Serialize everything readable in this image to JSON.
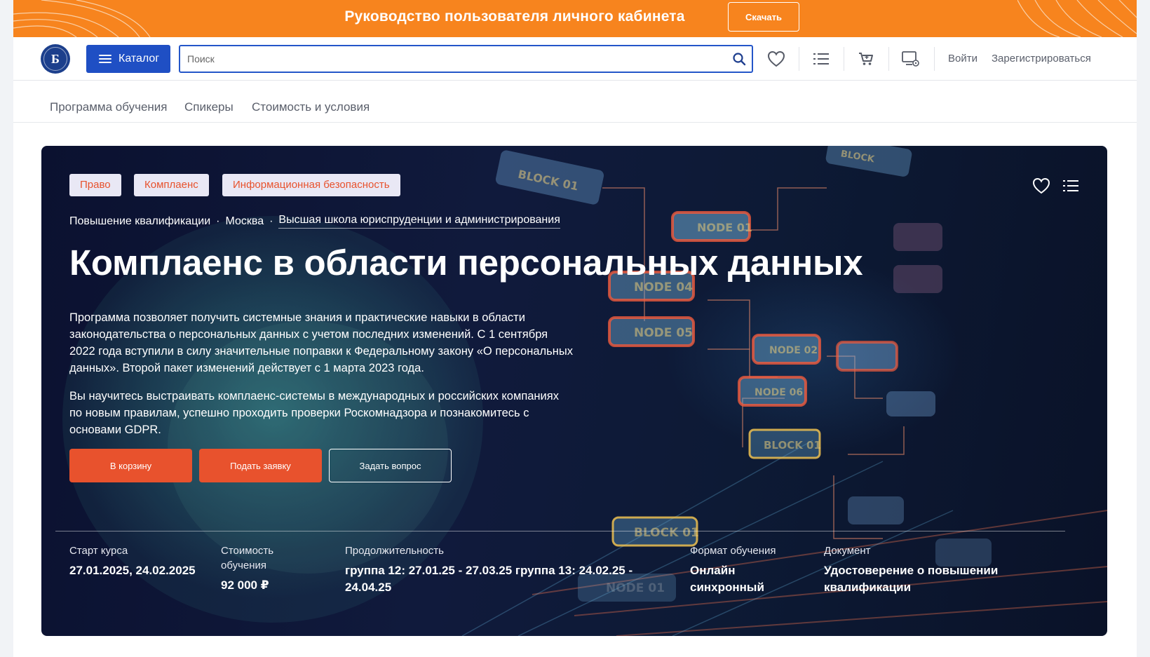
{
  "banner": {
    "title": "Руководство пользователя личного кабинета",
    "download_label": "Скачать",
    "color": "#f7841e"
  },
  "header": {
    "logo_letter": "Б",
    "catalog_label": "Каталог",
    "search_placeholder": "Поиск",
    "icons": [
      "heart-icon",
      "list-icon",
      "cart-icon",
      "lk-icon"
    ],
    "login_label": "Войти",
    "register_label": "Зарегистрироваться",
    "accent_color": "#1f4fc4"
  },
  "subnav": {
    "items": [
      "Программа обучения",
      "Спикеры",
      "Стоимость и условия"
    ]
  },
  "hero": {
    "tags": [
      "Право",
      "Комплаенс",
      "Информационная безопасность"
    ],
    "breadcrumbs": [
      "Повышение квалификации",
      "Москва",
      "Высшая школа юриспруденции и администрирования"
    ],
    "title": "Комплаенс в области персональных данных",
    "description": [
      "Программа позволяет получить системные знания и практические навыки в области законодательства о персональных данных с учетом последних изменений. С 1 сентября 2022 года вступили в силу значительные поправки к Федеральному закону «О персональных данных». Второй пакет изменений действует с 1 марта 2023 года.",
      "Вы научитесь выстраивать комплаенс-системы в международных и российских компаниях по новым правилам, успешно проходить проверки Роскомнадзора и познакомитесь с основами GDPR."
    ],
    "buttons": {
      "cart": "В корзину",
      "apply": "Подать заявку",
      "ask": "Задать вопрос"
    },
    "button_color": "#e8522d",
    "art_labels": [
      "BLOCK 01",
      "NODE 01",
      "NODE 04",
      "NODE 05",
      "NODE 02",
      "NODE 06",
      "BLOCK 01",
      "BLOCK 01",
      "NODE 01",
      "BLOCK"
    ],
    "info": [
      {
        "label": "Старт курса",
        "value": "27.01.2025, 24.02.2025"
      },
      {
        "label": "Стоимость обучения",
        "value": "92 000 ₽"
      },
      {
        "label": "Продолжительность",
        "value": "группа 12: 27.01.25 - 27.03.25 группа 13: 24.02.25 - 24.04.25"
      },
      {
        "label": "Формат обучения",
        "value": "Онлайн синхронный"
      },
      {
        "label": "Документ",
        "value": "Удостоверение о повышении квалификации"
      }
    ]
  }
}
